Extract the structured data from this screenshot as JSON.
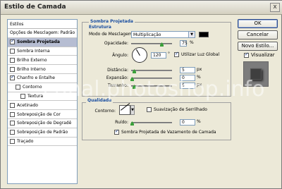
{
  "window": {
    "title": "Estilo de Camada",
    "close_glyph": "x"
  },
  "style_list": {
    "header": "Estilos",
    "items": [
      {
        "label": "Opções de Mesclagem: Padrão",
        "checkbox": false,
        "checked": false,
        "selected": false,
        "indent": 0
      },
      {
        "label": "Sombra Projetada",
        "checkbox": true,
        "checked": true,
        "selected": true,
        "indent": 0
      },
      {
        "label": "Sombra Interna",
        "checkbox": true,
        "checked": false,
        "selected": false,
        "indent": 0
      },
      {
        "label": "Brilho Externo",
        "checkbox": true,
        "checked": false,
        "selected": false,
        "indent": 0
      },
      {
        "label": "Brilho Interno",
        "checkbox": true,
        "checked": false,
        "selected": false,
        "indent": 0
      },
      {
        "label": "Chanfro e Entalhe",
        "checkbox": true,
        "checked": true,
        "selected": false,
        "indent": 0
      },
      {
        "label": "Contorno",
        "checkbox": true,
        "checked": false,
        "selected": false,
        "indent": 1
      },
      {
        "label": "Textura",
        "checkbox": true,
        "checked": false,
        "selected": false,
        "indent": 2
      },
      {
        "label": "Acetinado",
        "checkbox": true,
        "checked": false,
        "selected": false,
        "indent": 0
      },
      {
        "label": "Sobreposição de Cor",
        "checkbox": true,
        "checked": false,
        "selected": false,
        "indent": 0
      },
      {
        "label": "Sobreposição de Degradê",
        "checkbox": true,
        "checked": false,
        "selected": false,
        "indent": 0
      },
      {
        "label": "Sobreposição de Padrão",
        "checkbox": true,
        "checked": false,
        "selected": false,
        "indent": 0
      },
      {
        "label": "Traçado",
        "checkbox": true,
        "checked": false,
        "selected": false,
        "indent": 0
      }
    ]
  },
  "drop_shadow": {
    "section_title": "Sombra Projetada",
    "structure_title": "Estrutura",
    "blend_mode_label": "Modo de Mesclagem:",
    "blend_mode_value": "Multiplicação",
    "shadow_color": "#000000",
    "opacity_label": "Opacidade:",
    "opacity_value": "75",
    "opacity_unit": "%",
    "opacity_fraction": 0.75,
    "angle_label": "Ângulo:",
    "angle_value": "120",
    "angle_unit": "°",
    "global_light_label": "Utilizar Luz Global",
    "global_light_checked": true,
    "distance_label": "Distância:",
    "distance_value": "5",
    "distance_unit": "px",
    "spread_label": "Expansão:",
    "spread_value": "0",
    "spread_unit": "%",
    "size_label": "Tamanho:",
    "size_value": "5",
    "size_unit": "px",
    "quality_title": "Qualidade",
    "contour_label": "Contorno:",
    "anti_alias_label": "Suavização de Serrilhado",
    "anti_alias_checked": false,
    "noise_label": "Ruído:",
    "noise_value": "0",
    "noise_unit": "%",
    "knockout_label": "Sombra Projetada de Vazamento de Camada",
    "knockout_checked": true
  },
  "buttons": {
    "ok": "OK",
    "cancel": "Cancelar",
    "new_style": "Novo Estilo...",
    "preview_label": "Visualizar",
    "preview_checked": true
  },
  "watermark": "canal.photoshop.info"
}
